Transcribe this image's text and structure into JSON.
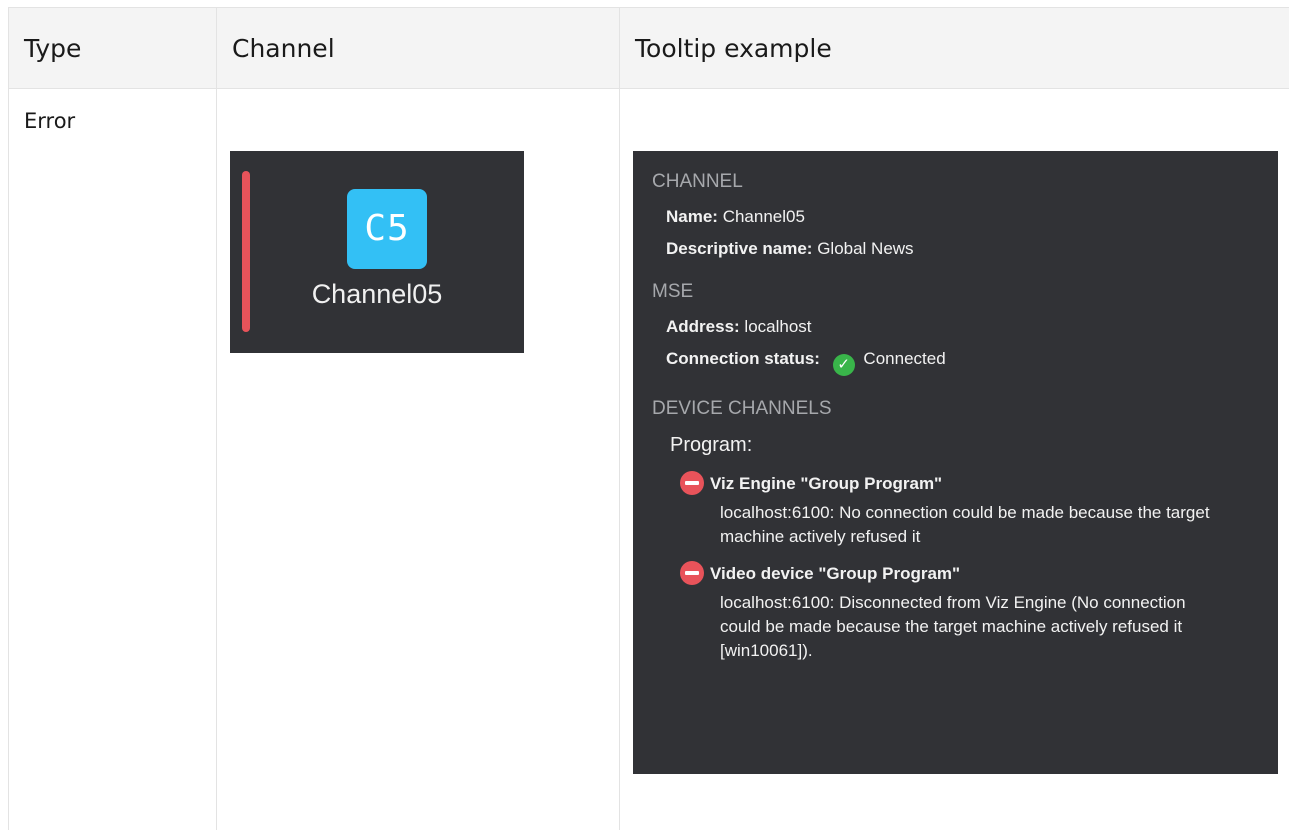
{
  "table": {
    "headers": {
      "type": "Type",
      "channel": "Channel",
      "tooltip": "Tooltip example"
    },
    "row": {
      "type": "Error",
      "channel_tile": {
        "badge_text": "C5",
        "name": "Channel05",
        "indicator_color": "#e8535a",
        "badge_color": "#33c0f5"
      },
      "tooltip": {
        "channel_section": {
          "title": "CHANNEL",
          "name_label": "Name:",
          "name_value": "Channel05",
          "descriptive_label": "Descriptive name:",
          "descriptive_value": "Global News"
        },
        "mse_section": {
          "title": "MSE",
          "address_label": "Address:",
          "address_value": "localhost",
          "status_label": "Connection status:",
          "status_value": "Connected",
          "status_icon": "check-circle-icon"
        },
        "devices_section": {
          "title": "DEVICE CHANNELS",
          "program_label": "Program:",
          "devices": [
            {
              "icon": "error-minus-icon",
              "title": "Viz Engine \"Group Program\"",
              "message": "localhost:6100: No connection could be made because the target machine actively refused it"
            },
            {
              "icon": "error-minus-icon",
              "title": "Video device \"Group Program\"",
              "message": "localhost:6100: Disconnected from Viz Engine (No connection could be made because the target machine actively refused it [win10061])."
            }
          ]
        }
      }
    }
  }
}
